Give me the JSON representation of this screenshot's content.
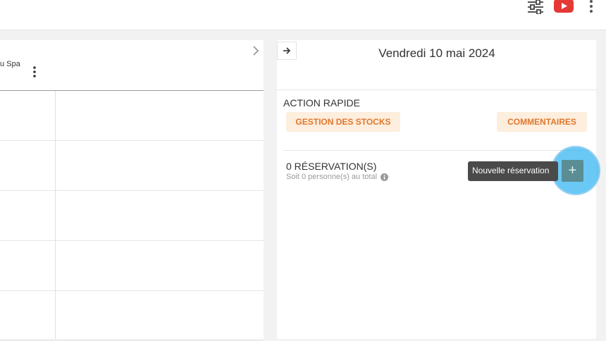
{
  "topbar": {
    "icons": [
      "sliders-icon",
      "youtube-icon",
      "more-vertical-icon"
    ],
    "youtube_color": "#e53935"
  },
  "calendar": {
    "resource_label": "u Spa",
    "rows": 5
  },
  "day_panel": {
    "title": "Vendredi 10 mai 2024",
    "quick_actions": {
      "title": "ACTION RAPIDE",
      "stock_label": "GESTION DES STOCKS",
      "comments_label": "COMMENTAIRES"
    },
    "reservations": {
      "count_label": "0 RÉSERVATION(S)",
      "persons_label": "Soit 0 personne(s) au total"
    },
    "add_tooltip": "Nouvelle réservation",
    "add_symbol": "+"
  },
  "colors": {
    "accent_orange": "#e0772e",
    "button_bg": "#fdeedd",
    "halo": "#38b6f0",
    "add_button": "#5b8d94"
  }
}
